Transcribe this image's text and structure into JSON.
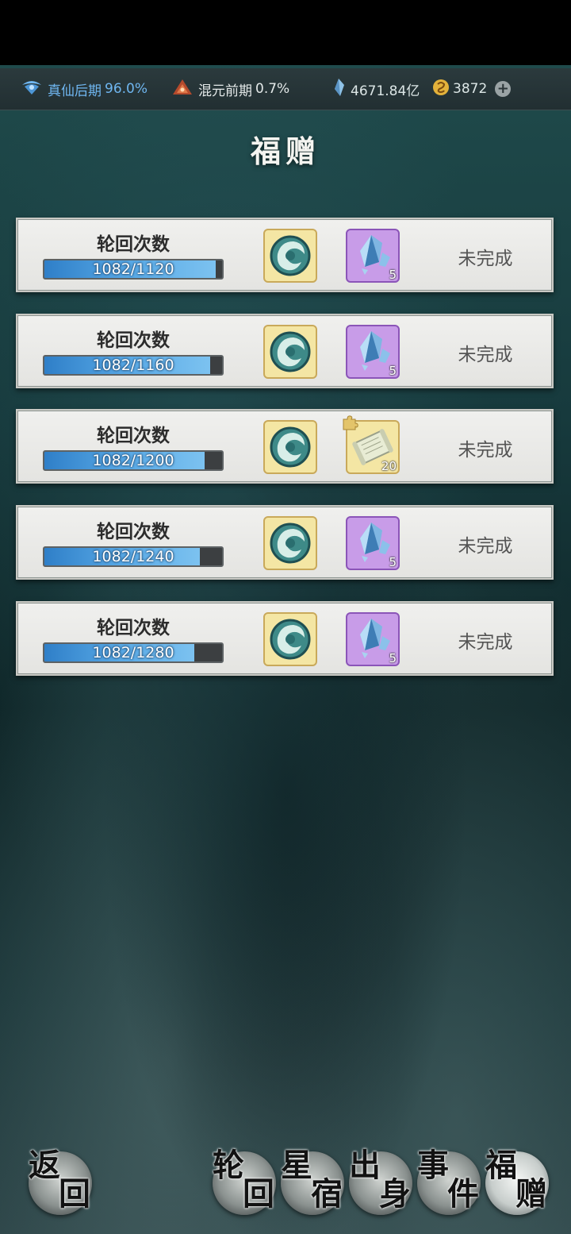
{
  "status_bar": {
    "realm": {
      "label": "真仙后期",
      "percent": "96.0%"
    },
    "next_realm": {
      "label": "混元前期",
      "percent": "0.7%"
    },
    "spirit_stones": "4671.84亿",
    "currency": "3872"
  },
  "page_title": "福赠",
  "rewards": [
    {
      "name": "轮回次数",
      "progress_text": "1082/1120",
      "progress_fraction": 0.966,
      "item1": "jade-pendant-icon",
      "item2": "crystal-shard-icon",
      "item2_count": "5",
      "item2_style": "purple",
      "status": "未完成"
    },
    {
      "name": "轮回次数",
      "progress_text": "1082/1160",
      "progress_fraction": 0.933,
      "item1": "jade-pendant-icon",
      "item2": "crystal-shard-icon",
      "item2_count": "5",
      "item2_style": "purple",
      "status": "未完成"
    },
    {
      "name": "轮回次数",
      "progress_text": "1082/1200",
      "progress_fraction": 0.902,
      "item1": "jade-pendant-icon",
      "item2": "scroll-fragment-icon",
      "item2_count": "20",
      "item2_style": "gold",
      "status": "未完成"
    },
    {
      "name": "轮回次数",
      "progress_text": "1082/1240",
      "progress_fraction": 0.873,
      "item1": "jade-pendant-icon",
      "item2": "crystal-shard-icon",
      "item2_count": "5",
      "item2_style": "purple",
      "status": "未完成"
    },
    {
      "name": "轮回次数",
      "progress_text": "1082/1280",
      "progress_fraction": 0.845,
      "item1": "jade-pendant-icon",
      "item2": "crystal-shard-icon",
      "item2_count": "5",
      "item2_style": "purple",
      "status": "未完成"
    }
  ],
  "nav": {
    "back": [
      "返",
      "回"
    ],
    "tabs": [
      {
        "id": "lunhui",
        "chars": [
          "轮",
          "回"
        ]
      },
      {
        "id": "xingxiu",
        "chars": [
          "星",
          "宿"
        ]
      },
      {
        "id": "chushen",
        "chars": [
          "出",
          "身"
        ]
      },
      {
        "id": "shijian",
        "chars": [
          "事",
          "件"
        ]
      },
      {
        "id": "fuzeng",
        "chars": [
          "福",
          "赠"
        ],
        "active": true
      }
    ]
  }
}
